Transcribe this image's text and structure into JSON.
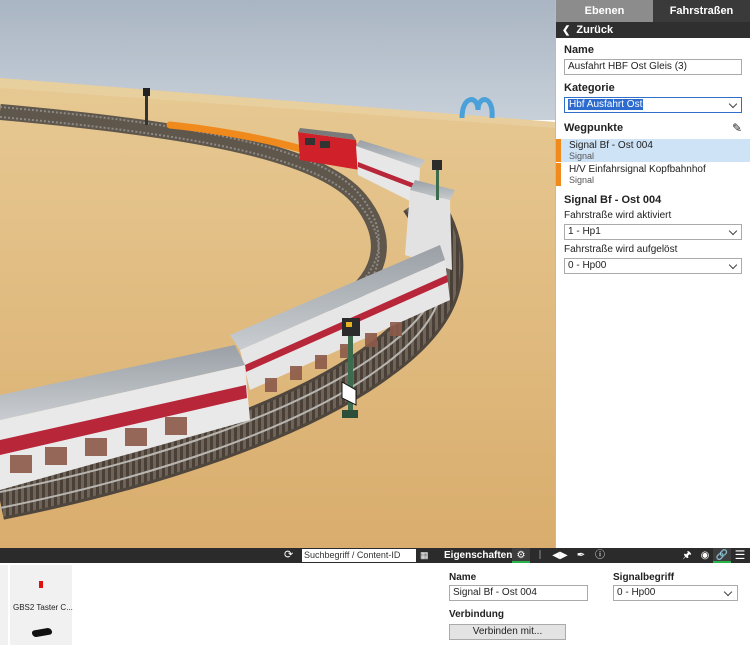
{
  "right_panel": {
    "tabs": [
      {
        "label": "Ebenen",
        "active": false
      },
      {
        "label": "Fahrstraßen",
        "active": true
      }
    ],
    "back_label": "Zurück",
    "name_label": "Name",
    "name_value": "Ausfahrt HBF Ost Gleis (3)",
    "kategorie_label": "Kategorie",
    "kategorie_value": "Hbf Ausfahrt Ost",
    "wegpunkte_label": "Wegpunkte",
    "waypoints": [
      {
        "title": "Signal Bf - Ost 004",
        "type": "Signal",
        "selected": true
      },
      {
        "title": "H/V Einfahrsignal Kopfbahnhof",
        "type": "Signal",
        "selected": false
      }
    ],
    "detail_title": "Signal Bf - Ost 004",
    "activated_label": "Fahrstraße wird aktiviert",
    "activated_value": "1 - Hp1",
    "released_label": "Fahrstraße wird aufgelöst",
    "released_value": "0 - Hp00"
  },
  "bottom_bar": {
    "search_placeholder": "Suchbegriff / Content-ID",
    "properties_label": "Eigenschaften",
    "icons": [
      "refresh-icon",
      "grid-icon",
      "gear-icon",
      "network-icon",
      "arrows-icon",
      "brush-icon",
      "info-icon",
      "pin-icon",
      "eye-icon",
      "link-icon",
      "menu-icon"
    ]
  },
  "catalog": {
    "items": [
      {
        "label": "GBS2 Taster C..."
      }
    ]
  },
  "properties": {
    "name_label": "Name",
    "name_value": "Signal Bf - Ost 004",
    "signal_label": "Signalbegriff",
    "signal_value": "0 - Hp00",
    "connection_label": "Verbindung",
    "connect_button": "Verbinden mit..."
  },
  "colors": {
    "accent_orange": "#f08a1c",
    "selected_blue": "#cfe3f7",
    "active_green": "#27b34a",
    "dark_bar": "#2b2b2b"
  }
}
